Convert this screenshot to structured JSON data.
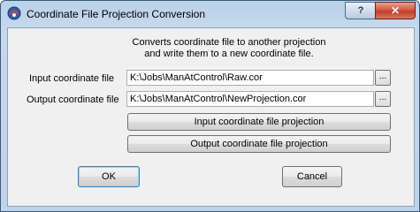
{
  "window": {
    "title": "Coordinate File Projection Conversion",
    "help_label": "?",
    "close_label": "✕"
  },
  "description": {
    "line1": "Converts coordinate file to another projection",
    "line2": "and write them to a new coordinate file."
  },
  "input_file": {
    "label": "Input coordinate file",
    "value": "K:\\Jobs\\ManAtControl\\Raw.cor",
    "browse_label": "..."
  },
  "output_file": {
    "label": "Output coordinate file",
    "value": "K:\\Jobs\\ManAtControl\\NewProjection.cor",
    "browse_label": "..."
  },
  "projection_buttons": {
    "input_label": "Input coordinate file projection",
    "output_label": "Output coordinate file projection"
  },
  "actions": {
    "ok_label": "OK",
    "cancel_label": "Cancel"
  }
}
